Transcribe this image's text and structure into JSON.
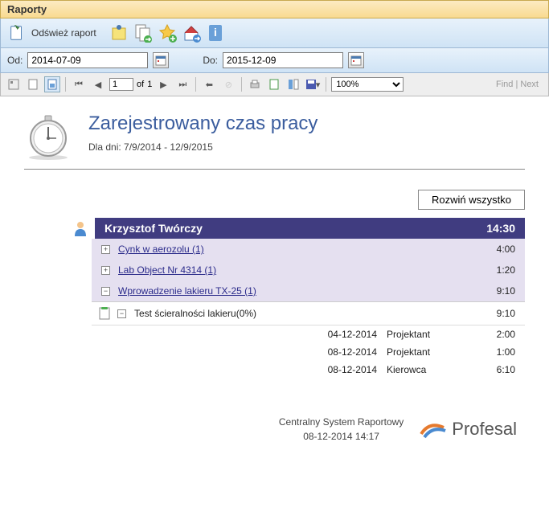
{
  "window": {
    "title": "Raporty"
  },
  "toolbar": {
    "refresh": "Odśwież raport"
  },
  "dates": {
    "from_label": "Od:",
    "from": "2014-07-09",
    "to_label": "Do:",
    "to": "2015-12-09"
  },
  "viewer": {
    "page": "1",
    "of": "of",
    "total": "1",
    "zoom": "100%",
    "find": "Find",
    "next": "Next"
  },
  "report": {
    "title": "Zarejestrowany czas pracy",
    "subtitle": "Dla dni: 7/9/2014 - 12/9/2015",
    "expand_all": "Rozwiń wszystko",
    "person": {
      "name": "Krzysztof Twórczy",
      "total": "14:30"
    },
    "groups": [
      {
        "expanded": false,
        "label": "Cynk w aerozolu (1)",
        "time": "4:00"
      },
      {
        "expanded": false,
        "label": "Lab Object Nr 4314 (1)",
        "time": "1:20"
      },
      {
        "expanded": true,
        "label": "Wprowadzenie lakieru TX-25 (1)",
        "time": "9:10"
      }
    ],
    "test": {
      "label": "Test ścieralności lakieru(0%)",
      "time": "9:10"
    },
    "details": [
      {
        "date": "04-12-2014",
        "role": "Projektant",
        "time": "2:00"
      },
      {
        "date": "08-12-2014",
        "role": "Projektant",
        "time": "1:00"
      },
      {
        "date": "08-12-2014",
        "role": "Kierowca",
        "time": "6:10"
      }
    ]
  },
  "footer": {
    "system": "Centralny System Raportowy",
    "timestamp": "08-12-2014 14:17",
    "brand": "Profesal"
  }
}
